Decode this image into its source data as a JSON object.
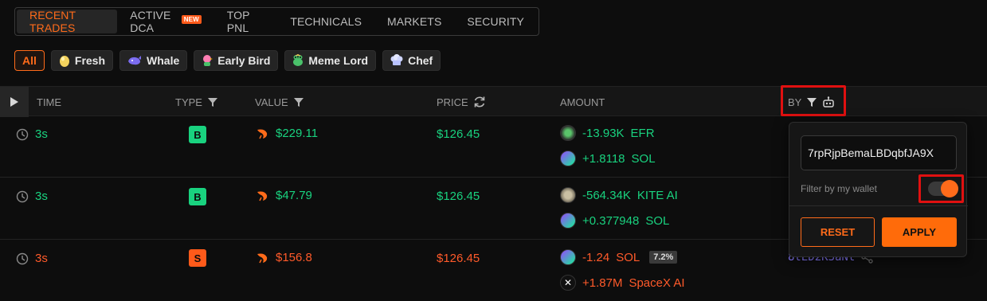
{
  "tabs": [
    {
      "label": "RECENT TRADES",
      "active": true
    },
    {
      "label": "ACTIVE DCA",
      "badge": "NEW"
    },
    {
      "label": "TOP PNL"
    },
    {
      "label": "TECHNICALS"
    },
    {
      "label": "MARKETS"
    },
    {
      "label": "SECURITY"
    }
  ],
  "chips": [
    {
      "label": "All",
      "active": true
    },
    {
      "label": "Fresh",
      "icon": "egg-icon"
    },
    {
      "label": "Whale",
      "icon": "whale-icon"
    },
    {
      "label": "Early Bird",
      "icon": "bird-icon"
    },
    {
      "label": "Meme Lord",
      "icon": "frog-icon"
    },
    {
      "label": "Chef",
      "icon": "chef-hat-icon"
    }
  ],
  "columns": {
    "time": "TIME",
    "type": "TYPE",
    "value": "VALUE",
    "price": "PRICE",
    "amount": "AMOUNT",
    "by": "BY"
  },
  "rows": [
    {
      "time": "3s",
      "side": "B",
      "value": "$229.11",
      "price": "$126.45",
      "amounts": [
        {
          "amount": "-13.93K",
          "token": "EFR",
          "icon": "efr-token-icon"
        },
        {
          "amount": "+1.8118",
          "token": "SOL",
          "icon": "sol-token-icon"
        }
      ]
    },
    {
      "time": "3s",
      "side": "B",
      "value": "$47.79",
      "price": "$126.45",
      "amounts": [
        {
          "amount": "-564.34K",
          "token": "KITE AI",
          "icon": "kite-token-icon"
        },
        {
          "amount": "+0.377948",
          "token": "SOL",
          "icon": "sol-token-icon"
        }
      ]
    },
    {
      "time": "3s",
      "side": "S",
      "value": "$156.8",
      "price": "$126.45",
      "amounts": [
        {
          "amount": "-1.24",
          "token": "SOL",
          "icon": "sol-token-icon",
          "pct": "7.2%"
        },
        {
          "amount": "+1.87M",
          "token": "SpaceX AI",
          "icon": "spacex-token-icon"
        }
      ],
      "by": "8tED2K3aNt"
    }
  ],
  "popover": {
    "wallet_value": "7rpRjpBemaLBDqbfJA9X",
    "filter_label": "Filter by my wallet",
    "reset_label": "RESET",
    "apply_label": "APPLY"
  },
  "colors": {
    "accent": "#ff6b1a",
    "buy": "#19d27f",
    "sell": "#ff5a2a",
    "highlight": "#e01010"
  }
}
